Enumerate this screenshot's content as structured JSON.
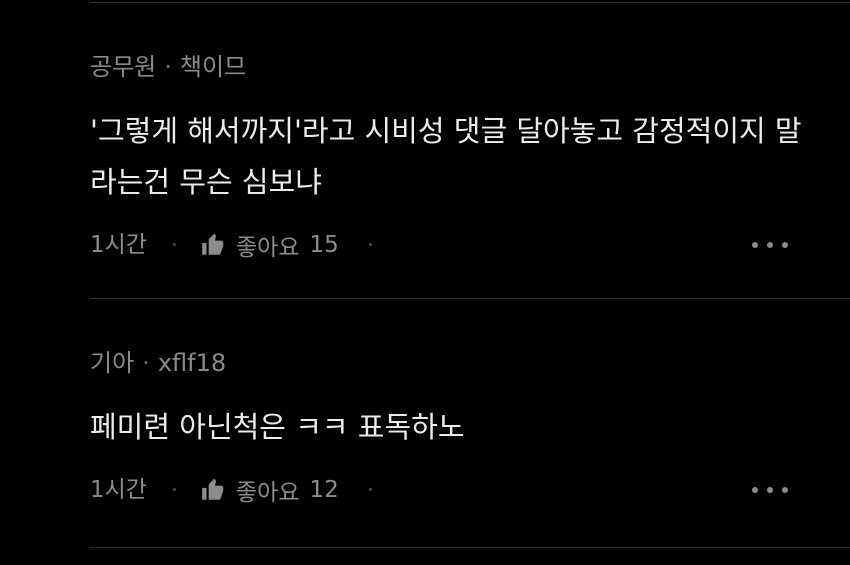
{
  "comments": [
    {
      "author": "공무원",
      "separator": "·",
      "user_id": "책이므",
      "body": "'그렇게 해서까지'라고 시비성 댓글 달아놓고 감정적이지 말라는건 무슨 심보냐",
      "time": "1시간",
      "like_label": "좋아요",
      "like_count": "15",
      "like_icon": "thumbs-up-icon",
      "more_icon": "more-icon"
    },
    {
      "author": "기아",
      "separator": "·",
      "user_id": "xflf18",
      "body": "페미련 아닌척은 ㅋㅋ 표독하노",
      "time": "1시간",
      "like_label": "좋아요",
      "like_count": "12",
      "like_icon": "thumbs-up-icon",
      "more_icon": "more-icon"
    }
  ],
  "colors": {
    "background": "#000000",
    "text_primary": "#ececec",
    "text_secondary": "#8a8a8a",
    "divider": "#2a2a2a"
  }
}
